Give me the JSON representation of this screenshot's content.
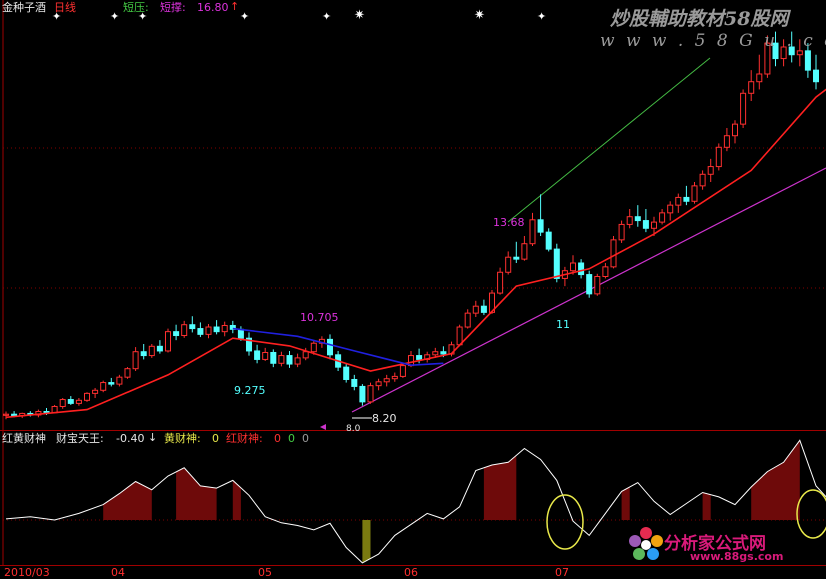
{
  "header": {
    "stock_name": "金种子酒",
    "period": "日线",
    "resist_label": "短压:",
    "support_label": "短撑:",
    "support_value": "16.80",
    "support_arrow": "↑"
  },
  "watermark": {
    "line1": "炒股輔助教材58股网",
    "line2": "w w w . 5 8 G u . c o m"
  },
  "annotations": {
    "low_point": "9.275",
    "mid_high": "10.705",
    "peak": "13.68",
    "retest": "11",
    "bottom": "8.20",
    "bottom_small": "8.0"
  },
  "indicator": {
    "name": "红黄财神",
    "king_label": "财宝天王:",
    "king_value": "-0.40",
    "king_arrow": "↓",
    "yellow_label": "黄财神:",
    "yellow_value": "0",
    "red_label": "红财神:",
    "red_value": "0",
    "extra1": "0",
    "extra2": "0"
  },
  "xaxis": {
    "labels": [
      "2010/03",
      "04",
      "05",
      "06",
      "07"
    ]
  },
  "brand": {
    "name": "分析家公式网",
    "url": "www.88gs.com"
  },
  "colors": {
    "background": "#000000",
    "up_candle": "#ff3030",
    "down_candle": "#54ffff",
    "ma_line": "#ff2020",
    "ma_blue": "#2020e0",
    "green_trend": "#44bb44",
    "magenta_trend": "#cc33cc",
    "red_area": "#6e0a0a",
    "yellow_area": "#7a7a10",
    "osc_line": "#ffffff",
    "circle": "#e8e84a",
    "grid": "#a00000"
  },
  "chart_data": {
    "type": "candlestick",
    "title": "金种子酒 日线",
    "candles": [
      [
        7.95,
        8.05,
        7.85,
        7.98
      ],
      [
        7.98,
        8.06,
        7.9,
        7.94
      ],
      [
        7.94,
        8.02,
        7.88,
        8.0
      ],
      [
        8.0,
        8.06,
        7.92,
        7.96
      ],
      [
        7.96,
        8.1,
        7.9,
        8.05
      ],
      [
        8.05,
        8.14,
        7.96,
        8.02
      ],
      [
        8.02,
        8.22,
        8.0,
        8.18
      ],
      [
        8.18,
        8.4,
        8.12,
        8.36
      ],
      [
        8.36,
        8.45,
        8.22,
        8.26
      ],
      [
        8.26,
        8.4,
        8.2,
        8.34
      ],
      [
        8.34,
        8.55,
        8.3,
        8.52
      ],
      [
        8.52,
        8.66,
        8.4,
        8.6
      ],
      [
        8.6,
        8.85,
        8.55,
        8.8
      ],
      [
        8.8,
        8.92,
        8.7,
        8.76
      ],
      [
        8.76,
        9.0,
        8.7,
        8.94
      ],
      [
        8.94,
        9.2,
        8.9,
        9.16
      ],
      [
        9.16,
        9.72,
        9.1,
        9.6
      ],
      [
        9.6,
        9.8,
        9.4,
        9.5
      ],
      [
        9.5,
        9.8,
        9.44,
        9.74
      ],
      [
        9.74,
        9.9,
        9.55,
        9.62
      ],
      [
        9.62,
        10.2,
        9.58,
        10.12
      ],
      [
        10.12,
        10.3,
        9.9,
        10.02
      ],
      [
        10.02,
        10.4,
        9.96,
        10.3
      ],
      [
        10.3,
        10.52,
        10.1,
        10.2
      ],
      [
        10.2,
        10.36,
        9.98,
        10.05
      ],
      [
        10.05,
        10.32,
        9.95,
        10.24
      ],
      [
        10.24,
        10.42,
        10.05,
        10.12
      ],
      [
        10.12,
        10.38,
        10.0,
        10.28
      ],
      [
        10.28,
        10.4,
        10.08,
        10.18
      ],
      [
        10.18,
        10.26,
        9.88,
        9.95
      ],
      [
        9.95,
        10.1,
        9.5,
        9.62
      ],
      [
        9.62,
        9.78,
        9.3,
        9.4
      ],
      [
        9.4,
        9.7,
        9.36,
        9.58
      ],
      [
        9.58,
        9.66,
        9.2,
        9.3
      ],
      [
        9.3,
        9.6,
        9.22,
        9.5
      ],
      [
        9.5,
        9.62,
        9.18,
        9.28
      ],
      [
        9.28,
        9.55,
        9.2,
        9.44
      ],
      [
        9.44,
        9.7,
        9.38,
        9.6
      ],
      [
        9.6,
        9.9,
        9.52,
        9.82
      ],
      [
        9.82,
        10.0,
        9.7,
        9.92
      ],
      [
        9.92,
        10.05,
        9.4,
        9.52
      ],
      [
        9.52,
        9.62,
        9.1,
        9.2
      ],
      [
        9.2,
        9.28,
        8.8,
        8.88
      ],
      [
        8.88,
        9.0,
        8.6,
        8.7
      ],
      [
        8.7,
        8.76,
        8.2,
        8.3
      ],
      [
        8.3,
        8.8,
        8.25,
        8.72
      ],
      [
        8.72,
        8.9,
        8.6,
        8.82
      ],
      [
        8.82,
        9.0,
        8.7,
        8.9
      ],
      [
        8.9,
        9.06,
        8.82,
        8.96
      ],
      [
        8.96,
        9.3,
        8.92,
        9.24
      ],
      [
        9.24,
        9.62,
        9.2,
        9.5
      ],
      [
        9.5,
        9.68,
        9.3,
        9.4
      ],
      [
        9.4,
        9.6,
        9.32,
        9.52
      ],
      [
        9.52,
        9.7,
        9.44,
        9.6
      ],
      [
        9.6,
        9.74,
        9.46,
        9.54
      ],
      [
        9.54,
        9.86,
        9.48,
        9.78
      ],
      [
        9.78,
        10.3,
        9.74,
        10.24
      ],
      [
        10.24,
        10.7,
        10.2,
        10.6
      ],
      [
        10.6,
        10.92,
        10.5,
        10.78
      ],
      [
        10.78,
        10.95,
        10.55,
        10.62
      ],
      [
        10.62,
        11.2,
        10.58,
        11.12
      ],
      [
        11.12,
        11.78,
        11.08,
        11.66
      ],
      [
        11.66,
        12.2,
        11.6,
        12.05
      ],
      [
        12.05,
        12.45,
        11.9,
        12.0
      ],
      [
        12.0,
        12.6,
        11.96,
        12.4
      ],
      [
        12.4,
        13.2,
        12.34,
        13.02
      ],
      [
        13.02,
        13.68,
        12.6,
        12.7
      ],
      [
        12.7,
        12.8,
        12.2,
        12.26
      ],
      [
        12.26,
        12.4,
        11.4,
        11.5
      ],
      [
        11.5,
        11.8,
        11.3,
        11.7
      ],
      [
        11.7,
        12.1,
        11.6,
        11.9
      ],
      [
        11.9,
        12.0,
        11.5,
        11.6
      ],
      [
        11.6,
        11.7,
        11.0,
        11.1
      ],
      [
        11.1,
        11.62,
        11.05,
        11.55
      ],
      [
        11.55,
        11.9,
        11.5,
        11.8
      ],
      [
        11.8,
        12.6,
        11.76,
        12.5
      ],
      [
        12.5,
        13.0,
        12.42,
        12.9
      ],
      [
        12.9,
        13.3,
        12.8,
        13.1
      ],
      [
        13.1,
        13.4,
        12.84,
        13.0
      ],
      [
        13.0,
        13.3,
        12.7,
        12.8
      ],
      [
        12.8,
        13.1,
        12.6,
        12.96
      ],
      [
        12.96,
        13.3,
        12.9,
        13.2
      ],
      [
        13.2,
        13.5,
        13.0,
        13.4
      ],
      [
        13.4,
        13.7,
        13.2,
        13.6
      ],
      [
        13.6,
        13.9,
        13.4,
        13.5
      ],
      [
        13.5,
        14.0,
        13.44,
        13.9
      ],
      [
        13.9,
        14.3,
        13.8,
        14.2
      ],
      [
        14.2,
        14.6,
        14.0,
        14.4
      ],
      [
        14.4,
        15.0,
        14.3,
        14.9
      ],
      [
        14.9,
        15.4,
        14.8,
        15.2
      ],
      [
        15.2,
        15.6,
        15.0,
        15.5
      ],
      [
        15.5,
        16.4,
        15.4,
        16.3
      ],
      [
        16.3,
        16.9,
        16.1,
        16.6
      ],
      [
        16.6,
        17.3,
        16.4,
        16.8
      ],
      [
        16.8,
        17.8,
        16.7,
        17.6
      ],
      [
        17.6,
        17.9,
        17.0,
        17.2
      ],
      [
        17.2,
        17.7,
        17.0,
        17.5
      ],
      [
        17.5,
        17.9,
        17.1,
        17.3
      ],
      [
        17.3,
        17.7,
        17.0,
        17.4
      ],
      [
        17.4,
        17.6,
        16.7,
        16.9
      ],
      [
        16.9,
        17.3,
        16.4,
        16.6
      ]
    ],
    "ma_red": [
      [
        0,
        7.9
      ],
      [
        10,
        8.1
      ],
      [
        20,
        9.0
      ],
      [
        28,
        9.95
      ],
      [
        35,
        9.75
      ],
      [
        45,
        9.1
      ],
      [
        55,
        9.55
      ],
      [
        63,
        11.3
      ],
      [
        72,
        11.75
      ],
      [
        80,
        12.65
      ],
      [
        92,
        14.3
      ],
      [
        100,
        16.2
      ],
      [
        105,
        17.0
      ]
    ],
    "ma_blue": [
      [
        28,
        10.2
      ],
      [
        36,
        10.0
      ],
      [
        43,
        9.62
      ],
      [
        50,
        9.25
      ],
      [
        54,
        9.3
      ]
    ],
    "osc": [
      [
        0,
        0.02
      ],
      [
        3,
        0.06
      ],
      [
        6,
        0.0
      ],
      [
        9,
        0.12
      ],
      [
        12,
        0.28
      ],
      [
        14,
        0.48
      ],
      [
        16,
        0.7
      ],
      [
        18,
        0.55
      ],
      [
        20,
        0.8
      ],
      [
        22,
        0.95
      ],
      [
        24,
        0.62
      ],
      [
        26,
        0.58
      ],
      [
        28,
        0.72
      ],
      [
        30,
        0.45
      ],
      [
        32,
        0.06
      ],
      [
        34,
        -0.05
      ],
      [
        36,
        -0.1
      ],
      [
        38,
        -0.18
      ],
      [
        40,
        -0.06
      ],
      [
        42,
        -0.5
      ],
      [
        44,
        -0.78
      ],
      [
        46,
        -0.62
      ],
      [
        48,
        -0.28
      ],
      [
        50,
        -0.08
      ],
      [
        52,
        0.12
      ],
      [
        54,
        0.02
      ],
      [
        56,
        0.24
      ],
      [
        58,
        0.9
      ],
      [
        60,
        1.0
      ],
      [
        62,
        1.05
      ],
      [
        64,
        1.3
      ],
      [
        66,
        1.1
      ],
      [
        68,
        0.72
      ],
      [
        70,
        -0.02
      ],
      [
        72,
        -0.28
      ],
      [
        74,
        0.12
      ],
      [
        76,
        0.52
      ],
      [
        78,
        0.68
      ],
      [
        80,
        0.34
      ],
      [
        82,
        0.1
      ],
      [
        84,
        0.3
      ],
      [
        86,
        0.5
      ],
      [
        88,
        0.42
      ],
      [
        90,
        0.28
      ],
      [
        92,
        0.6
      ],
      [
        94,
        0.88
      ],
      [
        96,
        1.05
      ],
      [
        98,
        1.45
      ],
      [
        100,
        0.62
      ],
      [
        102,
        0.3
      ],
      [
        104,
        0.18
      ],
      [
        105,
        0.1
      ]
    ],
    "red_areas": [
      [
        12,
        18
      ],
      [
        21,
        26
      ],
      [
        28,
        29
      ],
      [
        59,
        63
      ],
      [
        76,
        77
      ],
      [
        86,
        87
      ],
      [
        92,
        98
      ]
    ],
    "yellow_areas": [
      [
        44,
        45
      ]
    ],
    "xlabels": [
      "2010/03",
      "04",
      "05",
      "06",
      "07"
    ]
  }
}
